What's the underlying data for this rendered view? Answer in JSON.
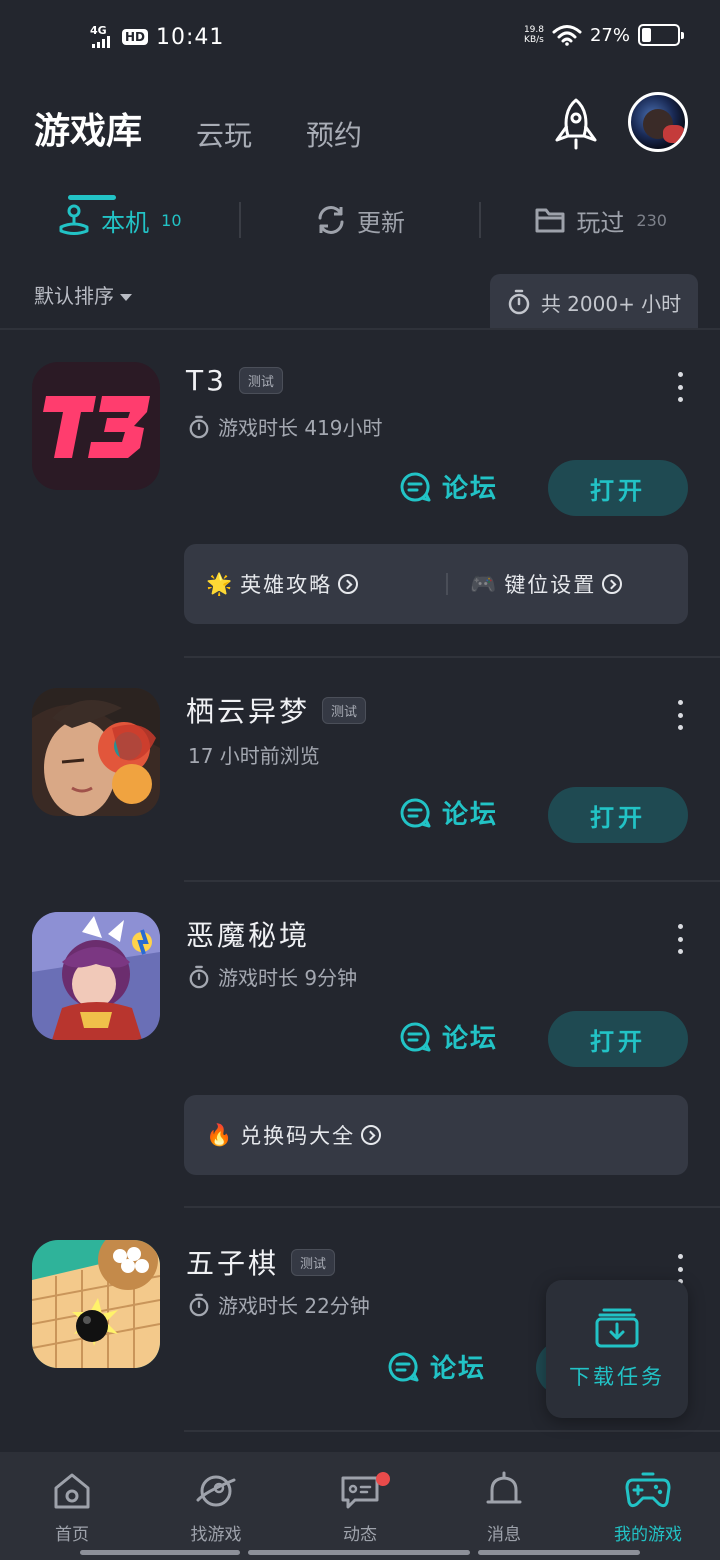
{
  "status_bar": {
    "network": "4G",
    "hd": "HD",
    "time": "10:41",
    "speed_value": "19.8",
    "speed_unit": "KB/s",
    "battery": "27%",
    "battery_level": 0.27
  },
  "top_tabs": [
    {
      "label": "游戏库",
      "active": true
    },
    {
      "label": "云玩",
      "active": false
    },
    {
      "label": "预约",
      "active": false
    }
  ],
  "sub_tabs": [
    {
      "label": "本机",
      "count": "10",
      "icon": "joystick-icon",
      "active": true
    },
    {
      "label": "更新",
      "count": "",
      "icon": "refresh-icon",
      "active": false
    },
    {
      "label": "玩过",
      "count": "230",
      "icon": "folder-icon",
      "active": false
    }
  ],
  "sort": {
    "label": "默认排序"
  },
  "total_time": {
    "label": "共 2000+ 小时"
  },
  "games": [
    {
      "name": "T3",
      "tag": "测试",
      "subtitle": "游戏时长 419小时",
      "has_timer_icon": true,
      "forum": "论坛",
      "open": "打开",
      "extras": [
        {
          "emoji": "🌟",
          "label": "英雄攻略"
        },
        {
          "emoji": "🎮",
          "label": "键位设置"
        }
      ]
    },
    {
      "name": "栖云异梦",
      "tag": "测试",
      "subtitle": "17 小时前浏览",
      "has_timer_icon": false,
      "forum": "论坛",
      "open": "打开",
      "extras": []
    },
    {
      "name": "恶魔秘境",
      "tag": "",
      "subtitle": "游戏时长 9分钟",
      "has_timer_icon": true,
      "forum": "论坛",
      "open": "打开",
      "extras": [
        {
          "emoji": "🔥",
          "label": "兑换码大全"
        }
      ]
    },
    {
      "name": "五子棋",
      "tag": "测试",
      "subtitle": "游戏时长 22分钟",
      "has_timer_icon": true,
      "forum": "论坛",
      "open": "",
      "extras": []
    }
  ],
  "download_float": {
    "label": "下载任务"
  },
  "bottom_nav": [
    {
      "label": "首页",
      "icon": "home-icon",
      "active": false
    },
    {
      "label": "找游戏",
      "icon": "planet-icon",
      "active": false
    },
    {
      "label": "动态",
      "icon": "chat-icon",
      "active": false,
      "badge": true
    },
    {
      "label": "消息",
      "icon": "bell-icon",
      "active": false
    },
    {
      "label": "我的游戏",
      "icon": "gamepad-icon",
      "active": true
    }
  ],
  "colors": {
    "background": "#23262e",
    "accent": "#22c3c6",
    "card": "#353944",
    "button_bg": "#1f4a52",
    "badge": "#e94b4b"
  }
}
